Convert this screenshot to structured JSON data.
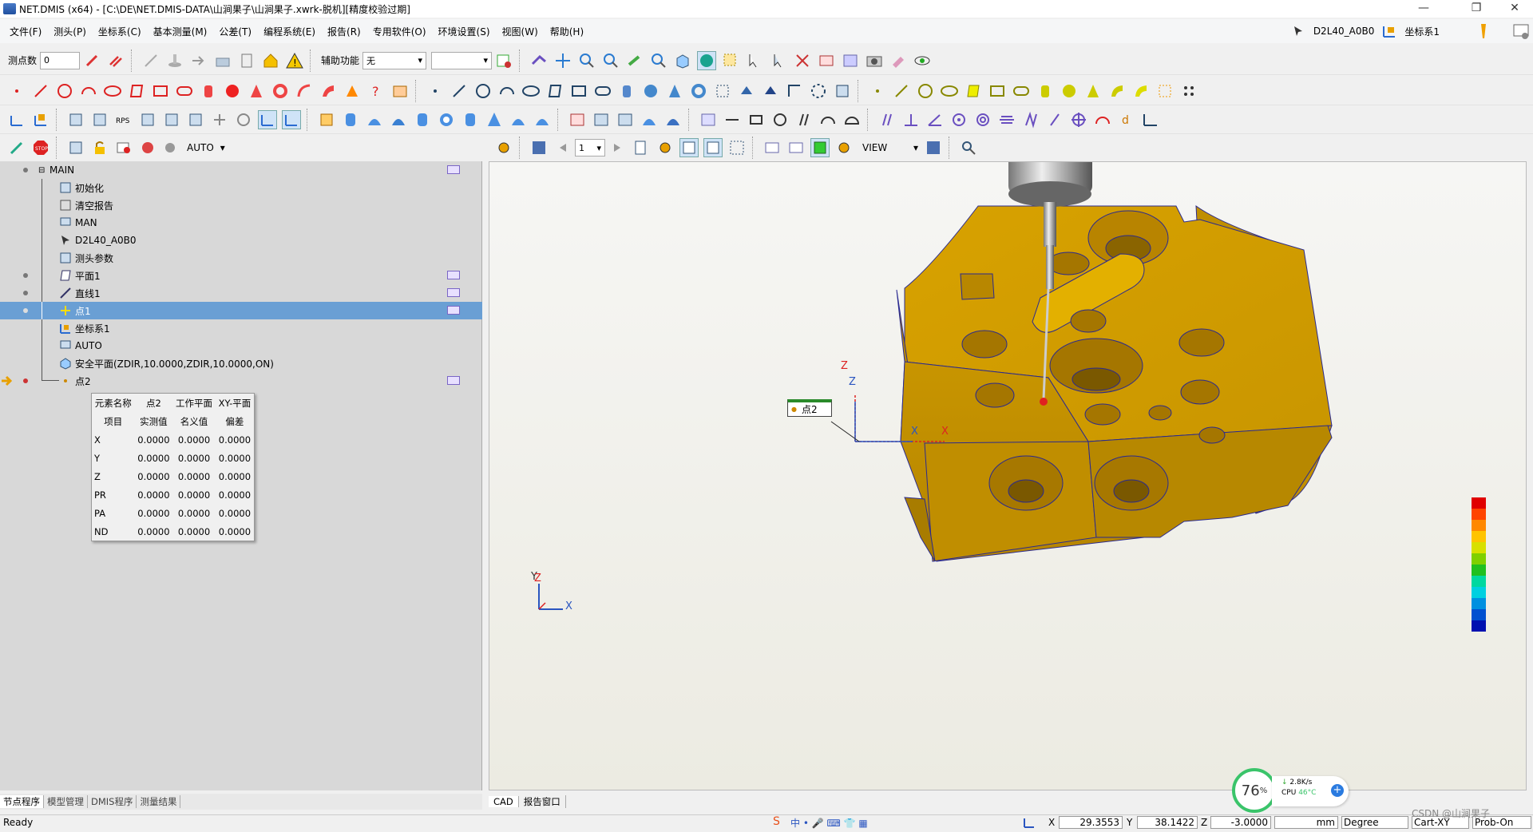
{
  "title": "NET.DMIS (x64) - [C:\\DE\\NET.DMIS-DATA\\山涧果子\\山涧果子.xwrk-脱机][精度校验过期]",
  "menu": [
    "文件(F)",
    "测头(P)",
    "坐标系(C)",
    "基本测量(M)",
    "公差(T)",
    "编程系统(E)",
    "报告(R)",
    "专用软件(O)",
    "环境设置(S)",
    "视图(W)",
    "帮助(H)"
  ],
  "header_right": {
    "probe": "D2L40_A0B0",
    "coord_system": "坐标系1"
  },
  "toolbar1": {
    "points_label": "测点数",
    "points_value": "0",
    "aux_label": "辅助功能",
    "aux_value": "无"
  },
  "left_toolbar": {
    "mode": "AUTO"
  },
  "tree": [
    {
      "label": "MAIN",
      "level": 0
    },
    {
      "label": "初始化",
      "level": 1
    },
    {
      "label": "清空报告",
      "level": 1
    },
    {
      "label": "MAN",
      "level": 1
    },
    {
      "label": "D2L40_A0B0",
      "level": 1
    },
    {
      "label": "测头参数",
      "level": 1
    },
    {
      "label": "平面1",
      "level": 1
    },
    {
      "label": "直线1",
      "level": 1
    },
    {
      "label": "点1",
      "level": 1,
      "selected": true
    },
    {
      "label": "坐标系1",
      "level": 1
    },
    {
      "label": "AUTO",
      "level": 1
    },
    {
      "label": "安全平面(ZDIR,10.0000,ZDIR,10.0000,ON)",
      "level": 1
    },
    {
      "label": "点2",
      "level": 1,
      "current": true
    }
  ],
  "popup": {
    "name_label": "元素名称",
    "name_value": "点2",
    "plane_label": "工作平面",
    "plane_value": "XY-平面",
    "headers": [
      "项目",
      "实测值",
      "名义值",
      "偏差"
    ],
    "rows": [
      [
        "X",
        "0.0000",
        "0.0000",
        "0.0000"
      ],
      [
        "Y",
        "0.0000",
        "0.0000",
        "0.0000"
      ],
      [
        "Z",
        "0.0000",
        "0.0000",
        "0.0000"
      ],
      [
        "PR",
        "0.0000",
        "0.0000",
        "0.0000"
      ],
      [
        "PA",
        "0.0000",
        "0.0000",
        "0.0000"
      ],
      [
        "ND",
        "0.0000",
        "0.0000",
        "0.0000"
      ]
    ]
  },
  "left_tabs": [
    "节点程序",
    "模型管理",
    "DMIS程序",
    "测量结果"
  ],
  "view_toolbar": {
    "page": "1",
    "view": "VIEW"
  },
  "cad_tabs": [
    "CAD",
    "报告窗口"
  ],
  "cad_label": "点2",
  "axes": {
    "x": "X",
    "y": "Y",
    "z": "Z"
  },
  "cpu_widget": {
    "percent": "76",
    "percent_unit": "%",
    "net": "2.8K/s",
    "cpu": "CPU",
    "temp": "46°C"
  },
  "status": {
    "ready": "Ready",
    "x_label": "X",
    "x": "29.3553",
    "y_label": "Y",
    "y": "38.1422",
    "z_label": "Z",
    "z": "-3.0000",
    "unit": "mm",
    "angle": "Degree",
    "coord": "Cart-XY",
    "prob": "Prob-On",
    "watermark": "CSDN @山涧果子"
  },
  "colors": {
    "part": "#d9a000",
    "selection": "#6a9fd4",
    "tree_bg": "#d8d8d8"
  }
}
